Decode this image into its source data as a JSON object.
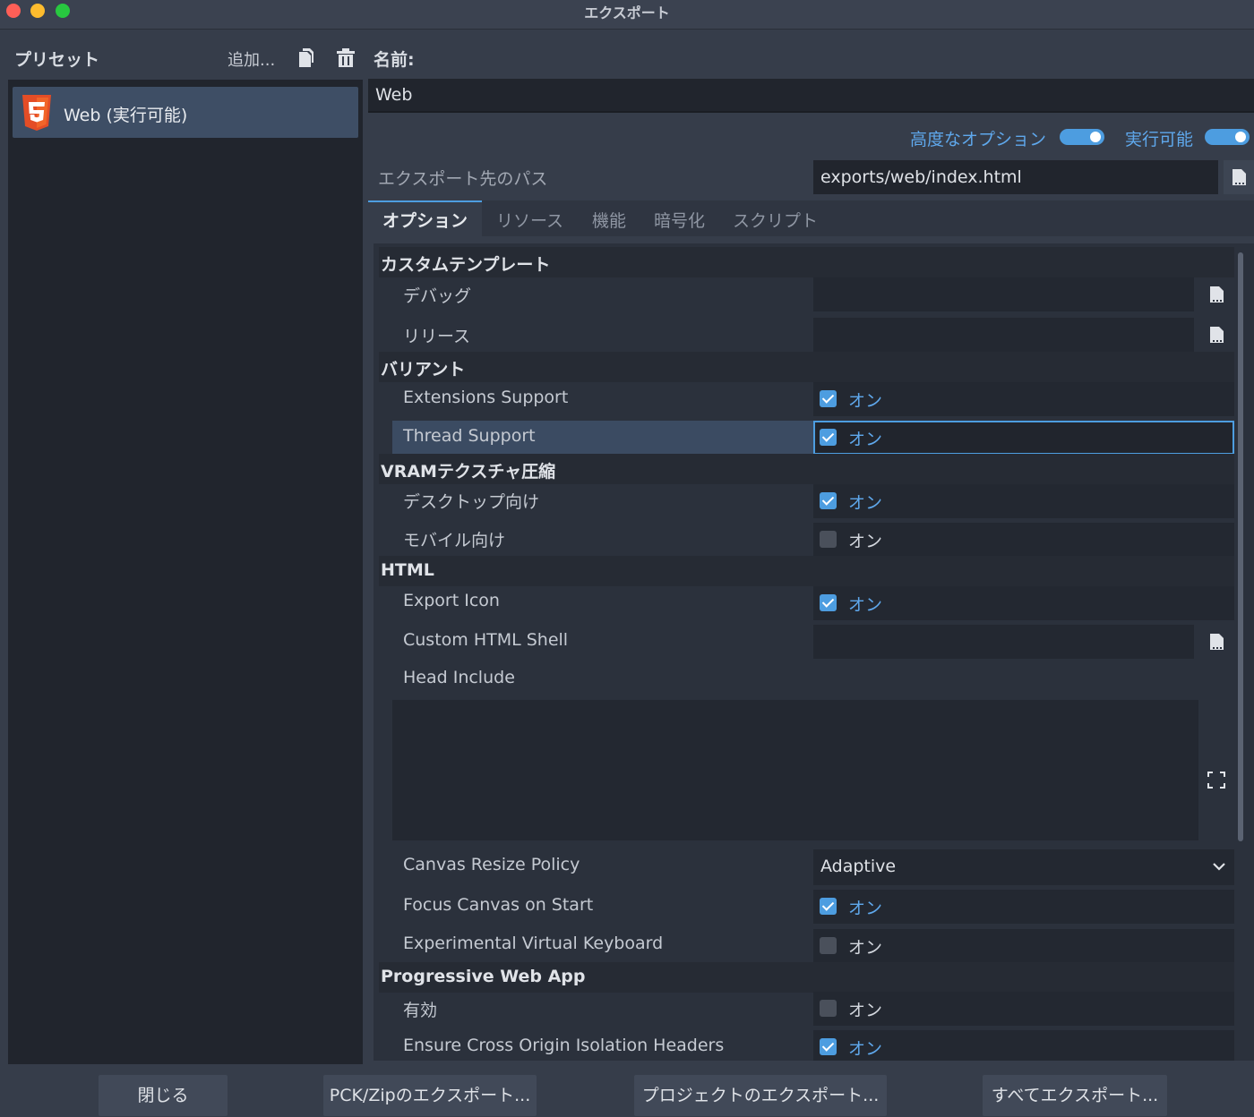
{
  "window": {
    "title": "エクスポート"
  },
  "presets": {
    "label": "プリセット",
    "add_label": "追加...",
    "items": [
      {
        "label": "Web (実行可能)",
        "icon": "html5-icon"
      }
    ]
  },
  "name": {
    "label": "名前:",
    "value": "Web"
  },
  "toggles": {
    "advanced_label": "高度なオプション",
    "advanced_on": true,
    "runnable_label": "実行可能",
    "runnable_on": true
  },
  "export_path": {
    "label": "エクスポート先のパス",
    "value": "exports/web/index.html"
  },
  "tabs": [
    {
      "label": "オプション",
      "active": true
    },
    {
      "label": "リソース",
      "active": false
    },
    {
      "label": "機能",
      "active": false
    },
    {
      "label": "暗号化",
      "active": false
    },
    {
      "label": "スクリプト",
      "active": false
    }
  ],
  "on_text": "オン",
  "sections": {
    "custom_template": {
      "title": "カスタムテンプレート",
      "debug_label": "デバッグ",
      "release_label": "リリース"
    },
    "variant": {
      "title": "バリアント",
      "extensions_label": "Extensions Support",
      "extensions_on": true,
      "thread_label": "Thread Support",
      "thread_on": true
    },
    "vram": {
      "title": "VRAMテクスチャ圧縮",
      "desktop_label": "デスクトップ向け",
      "desktop_on": true,
      "mobile_label": "モバイル向け",
      "mobile_on": false
    },
    "html": {
      "title": "HTML",
      "export_icon_label": "Export Icon",
      "export_icon_on": true,
      "custom_shell_label": "Custom HTML Shell",
      "head_include_label": "Head Include",
      "canvas_resize_label": "Canvas Resize Policy",
      "canvas_resize_value": "Adaptive",
      "focus_canvas_label": "Focus Canvas on Start",
      "focus_canvas_on": true,
      "virtual_keyboard_label": "Experimental Virtual Keyboard",
      "virtual_keyboard_on": false
    },
    "pwa": {
      "title": "Progressive Web App",
      "enabled_label": "有効",
      "enabled_on": false,
      "coi_label": "Ensure Cross Origin Isolation Headers",
      "coi_on": true
    }
  },
  "footer": {
    "close": "閉じる",
    "export_pck": "PCK/Zipのエクスポート...",
    "export_project": "プロジェクトのエクスポート...",
    "export_all": "すべてエクスポート..."
  },
  "colors": {
    "accent": "#4d9de0",
    "on_text": "#5fa8ec",
    "selection": "#3e4e65"
  }
}
